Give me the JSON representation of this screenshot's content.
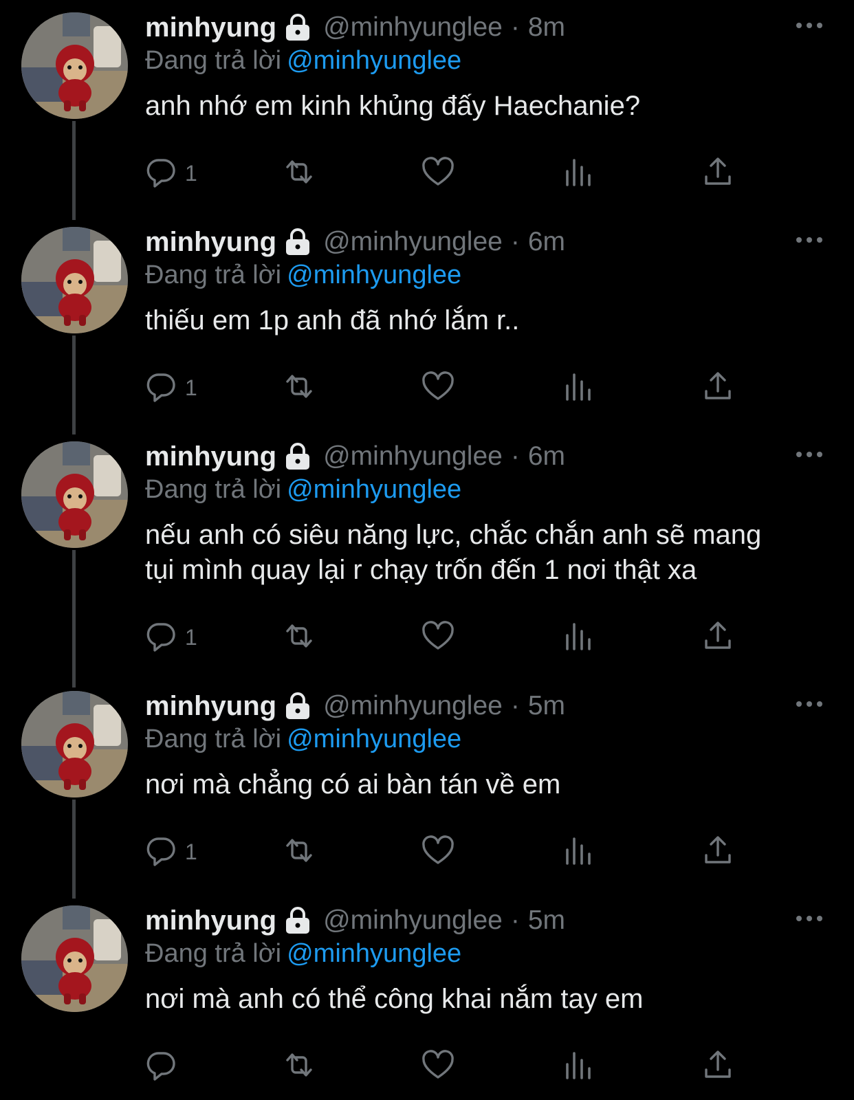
{
  "tweets": [
    {
      "name": "minhyung",
      "handle": "@minhyunglee",
      "time": "8m",
      "reply_prefix": "Đang trả lời",
      "reply_to": "@minhyunglee",
      "text": "anh nhớ em kinh khủng đấy Haechanie?",
      "reply_count": "1"
    },
    {
      "name": "minhyung",
      "handle": "@minhyunglee",
      "time": "6m",
      "reply_prefix": "Đang trả lời",
      "reply_to": "@minhyunglee",
      "text": "thiếu em 1p anh đã nhớ lắm r..",
      "reply_count": "1"
    },
    {
      "name": "minhyung",
      "handle": "@minhyunglee",
      "time": "6m",
      "reply_prefix": "Đang trả lời",
      "reply_to": "@minhyunglee",
      "text": "nếu anh có siêu năng lực, chắc chắn anh sẽ mang\ntụi mình quay lại r chạy trốn đến 1 nơi thật xa",
      "reply_count": "1"
    },
    {
      "name": "minhyung",
      "handle": "@minhyunglee",
      "time": "5m",
      "reply_prefix": "Đang trả lời",
      "reply_to": "@minhyunglee",
      "text": "nơi mà chẳng có ai bàn tán về em",
      "reply_count": "1"
    },
    {
      "name": "minhyung",
      "handle": "@minhyunglee",
      "time": "5m",
      "reply_prefix": "Đang trả lời",
      "reply_to": "@minhyunglee",
      "text": "nơi mà anh có thể công khai nắm tay em",
      "reply_count": ""
    }
  ],
  "separator": "·",
  "icons": {
    "more": "more-horizontal-icon",
    "lock": "lock-icon",
    "reply": "reply-bubble-icon",
    "retweet": "retweet-icon",
    "like": "heart-icon",
    "views": "views-bar-chart-icon",
    "share": "share-upload-icon"
  },
  "colors": {
    "background": "#000000",
    "primary_text": "#e7e9ea",
    "secondary_text": "#71767b",
    "link": "#1d9bf0",
    "thread_line": "#3e4144"
  }
}
